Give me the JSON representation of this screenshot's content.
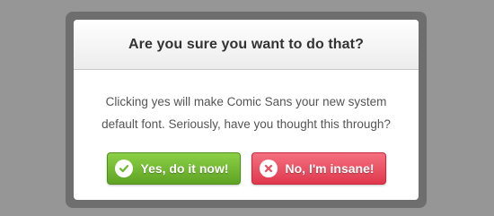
{
  "dialog": {
    "title": "Are you sure you want to do that?",
    "message": "Clicking yes will make Comic Sans your new system default font. Seriously, have you thought this through?"
  },
  "actions": {
    "confirm": {
      "label": "Yes, do it now!",
      "icon": "check-icon",
      "color": "#6cb52d"
    },
    "cancel": {
      "label": "No, I'm insane!",
      "icon": "close-icon",
      "color": "#ea4d60"
    }
  }
}
